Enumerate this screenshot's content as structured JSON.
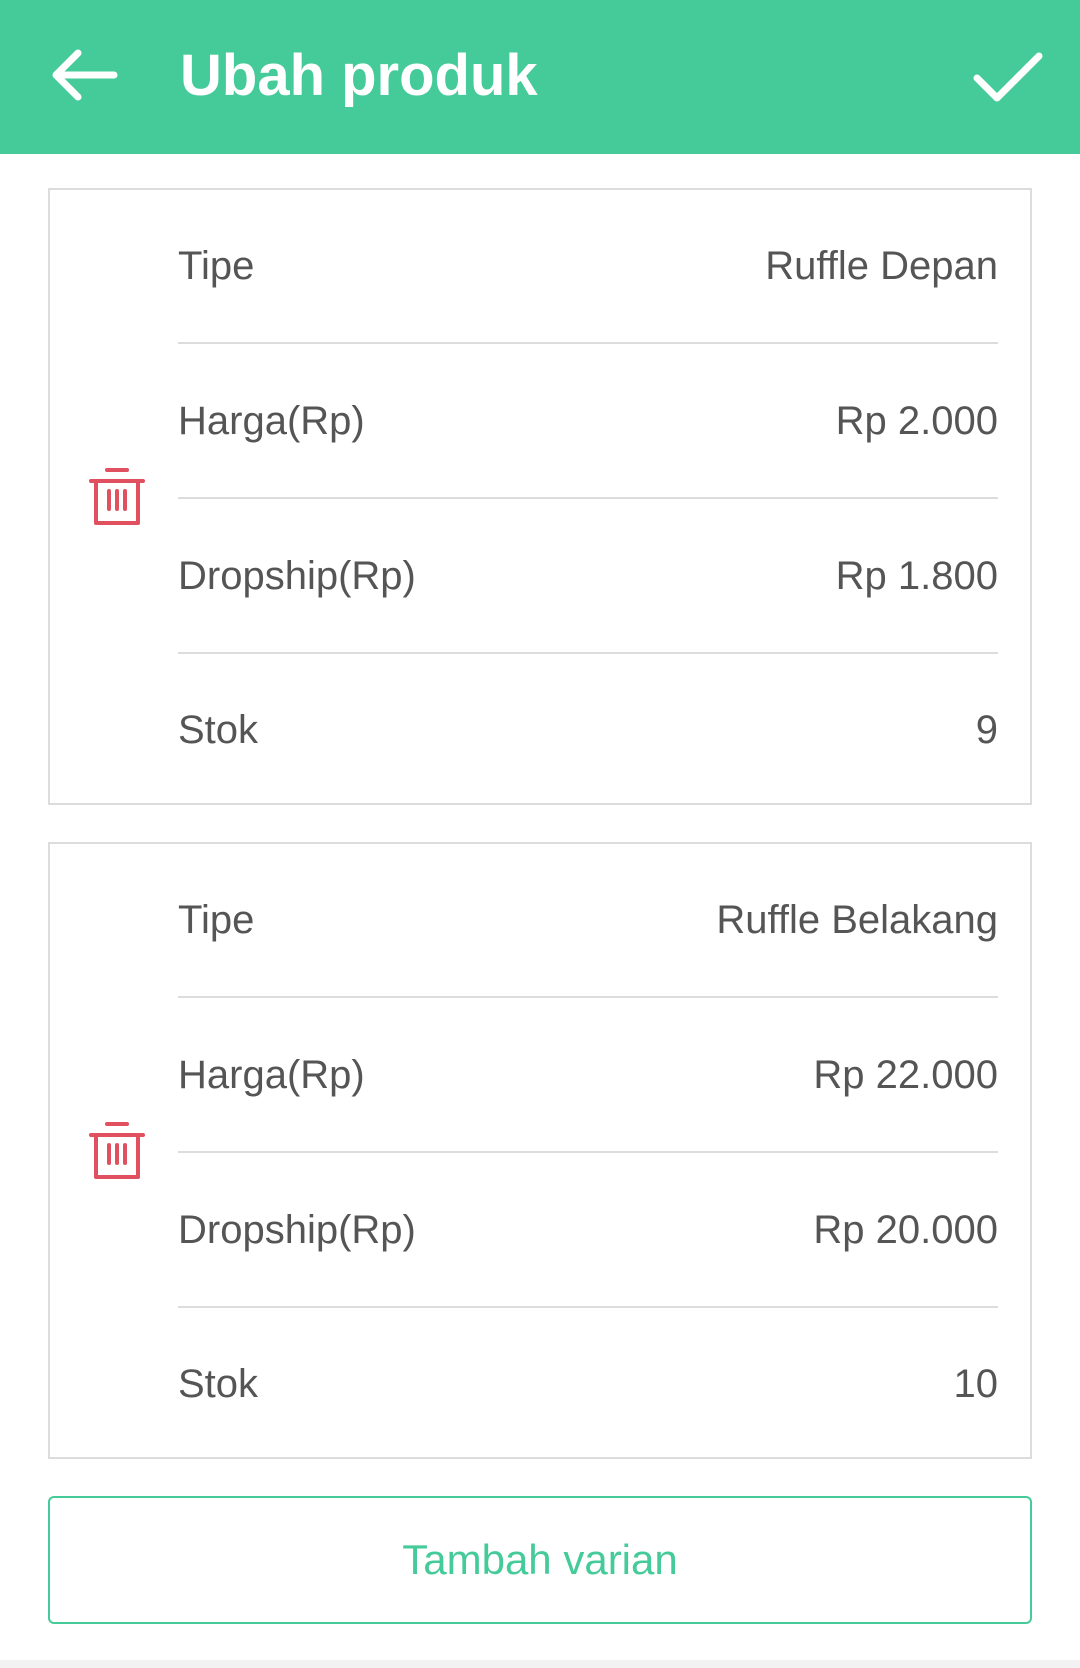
{
  "appbar": {
    "title": "Ubah produk",
    "back_icon": "arrow-left-icon",
    "confirm_icon": "check-icon",
    "color": "#45cb99"
  },
  "variants": [
    {
      "fields": [
        {
          "label": "Tipe",
          "value": "Ruffle Depan"
        },
        {
          "label": "Harga(Rp)",
          "value": "Rp 2.000"
        },
        {
          "label": "Dropship(Rp)",
          "value": "Rp 1.800"
        },
        {
          "label": "Stok",
          "value": "9"
        }
      ]
    },
    {
      "fields": [
        {
          "label": "Tipe",
          "value": "Ruffle Belakang"
        },
        {
          "label": "Harga(Rp)",
          "value": "Rp 22.000"
        },
        {
          "label": "Dropship(Rp)",
          "value": "Rp 20.000"
        },
        {
          "label": "Stok",
          "value": "10"
        }
      ]
    }
  ],
  "delete_icon": "trash-icon",
  "delete_color": "#e0505e",
  "add_variant_label": "Tambah varian"
}
